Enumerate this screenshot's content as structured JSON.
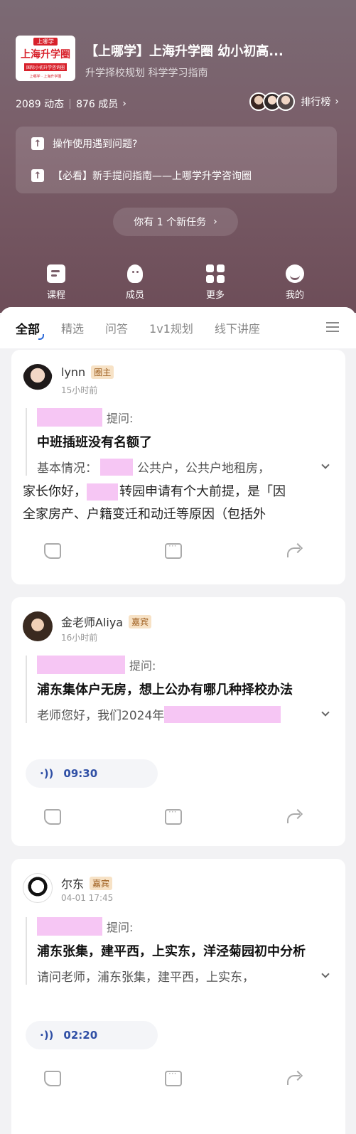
{
  "group": {
    "logo_tag": "上哪学",
    "logo_title": "上海升学圈",
    "logo_strip": "国际小初升学咨询圈",
    "logo_small": "上哪学 · 上海升学圈",
    "title": "【上哪学】上海升学圈 幼小初高...",
    "subtitle": "升学择校规划 科学学习指南",
    "posts": "2089 动态",
    "members": "876 成员",
    "ranking_label": "排行榜"
  },
  "notices": [
    {
      "text": "操作使用遇到问题?"
    },
    {
      "text": "【必看】新手提问指南——上哪学升学咨询圈"
    }
  ],
  "task": {
    "label": "你有 1 个新任务"
  },
  "tabs": [
    {
      "label": "课程",
      "icon": "course-icon"
    },
    {
      "label": "成员",
      "icon": "member-icon"
    },
    {
      "label": "更多",
      "icon": "grid-icon"
    },
    {
      "label": "我的",
      "icon": "profile-icon"
    }
  ],
  "filters": [
    "全部",
    "精选",
    "问答",
    "1v1规划",
    "线下讲座"
  ],
  "posts": [
    {
      "author": "lynn",
      "badge": "圈主",
      "time": "15小时前",
      "question_suffix": "提问:",
      "question_title": "中班插班没有名额了",
      "question_body_prefix": "基本情况：",
      "question_body_suffix": "公共户，公共户地租房，",
      "answer_line1_prefix": "家长你好，",
      "answer_line1_suffix": "转园申请有个大前提，是「因",
      "answer_line2": "全家房产、户籍变迁和动迁等原因（包括外"
    },
    {
      "author": "金老师Aliya",
      "badge": "嘉宾",
      "time": "16小时前",
      "question_suffix": "提问:",
      "question_title": "浦东集体户无房，想上公办有哪几种择校办法",
      "question_body_prefix": "老师您好，我们2024年",
      "voice_duration": "09:30"
    },
    {
      "author": "尔东",
      "badge": "嘉宾",
      "time": "04-01 17:45",
      "question_suffix": "提问:",
      "question_title": "浦东张集，建平西，上实东，洋泾菊园初中分析",
      "question_body_prefix": "请问老师，浦东张集，建平西，上实东，",
      "voice_duration": "02:20"
    }
  ],
  "colors": {
    "header": "#7a5e69",
    "badge_bg": "#f7e2c6",
    "voice": "#2f4fa5",
    "blur": "#f6c6f4"
  }
}
